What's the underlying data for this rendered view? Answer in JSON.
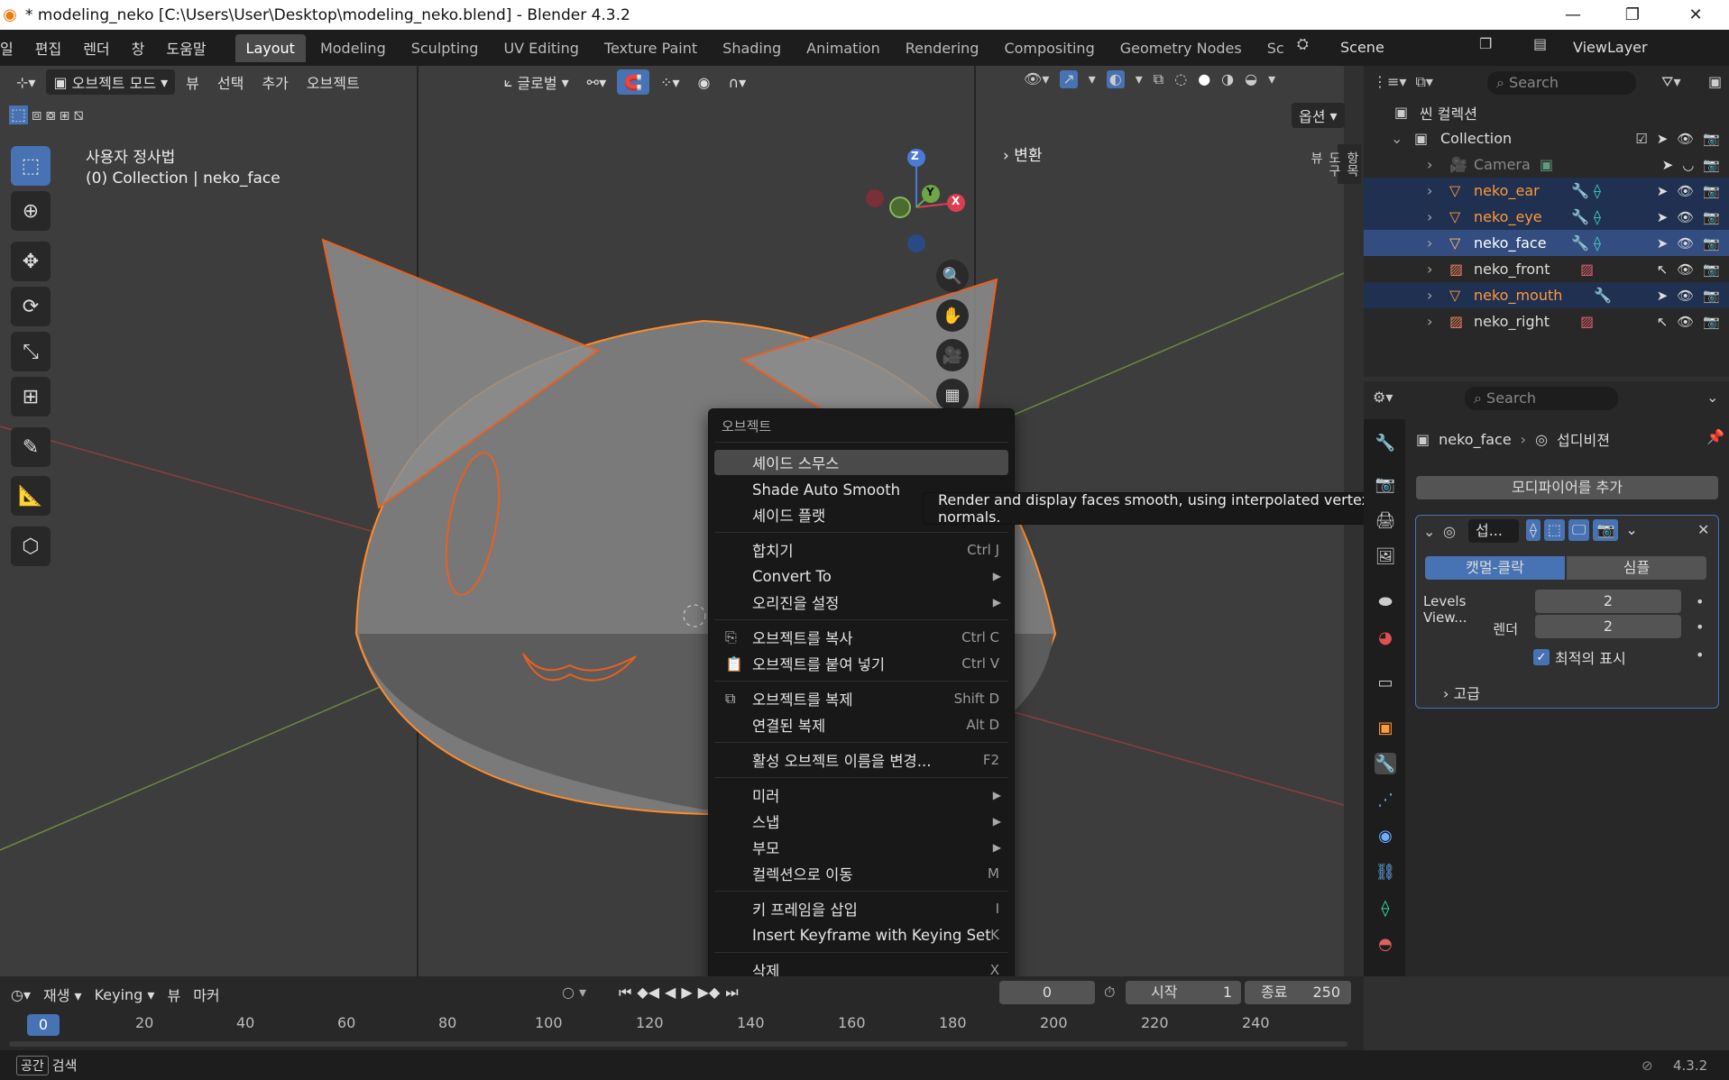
{
  "titlebar": {
    "title": "* modeling_neko [C:\\Users\\User\\Desktop\\modeling_neko.blend] - Blender 4.3.2",
    "minimize": "—",
    "maximize": "❐",
    "close": "✕"
  },
  "menubar": {
    "items": [
      "일",
      "편집",
      "렌더",
      "창",
      "도움말"
    ],
    "workspaces": [
      "Layout",
      "Modeling",
      "Sculpting",
      "UV Editing",
      "Texture Paint",
      "Shading",
      "Animation",
      "Rendering",
      "Compositing",
      "Geometry Nodes",
      "Sc"
    ],
    "active_workspace": "Layout",
    "scene": "Scene",
    "view_layer": "ViewLayer"
  },
  "viewport_header": {
    "mode": "오브젝트 모드",
    "menus": [
      "뷰",
      "선택",
      "추가",
      "오브젝트"
    ],
    "transform_orientation": "글로벌",
    "options": "옵션"
  },
  "viewport": {
    "view_name": "사용자 정사법",
    "collection_info": "(0) Collection | neko_face",
    "sidebar_panel": "변환",
    "side_tabs": [
      "항목",
      "도구",
      "뷰"
    ],
    "gizmo": {
      "z": "Z",
      "y": "Y",
      "x": "X"
    }
  },
  "context_menu": {
    "title": "오브젝트",
    "items": [
      {
        "label": "셰이드 스무스",
        "shortcut": "",
        "submenu": false,
        "highlighted": true
      },
      {
        "label": "Shade Auto Smooth",
        "shortcut": "",
        "submenu": false
      },
      {
        "label": "셰이드 플랫",
        "shortcut": "",
        "submenu": false
      },
      {
        "label": "합치기",
        "shortcut": "Ctrl J",
        "submenu": false
      },
      {
        "label": "Convert To",
        "shortcut": "",
        "submenu": true
      },
      {
        "label": "오리진을 설정",
        "shortcut": "",
        "submenu": true
      },
      {
        "label": "오브젝트를 복사",
        "shortcut": "Ctrl C",
        "submenu": false
      },
      {
        "label": "오브젝트를 붙여 넣기",
        "shortcut": "Ctrl V",
        "submenu": false
      },
      {
        "label": "오브젝트를 복제",
        "shortcut": "Shift D",
        "submenu": false
      },
      {
        "label": "연결된 복제",
        "shortcut": "Alt D",
        "submenu": false
      },
      {
        "label": "활성 오브젝트 이름을 변경...",
        "shortcut": "F2",
        "submenu": false
      },
      {
        "label": "미러",
        "shortcut": "",
        "submenu": true
      },
      {
        "label": "스냅",
        "shortcut": "",
        "submenu": true
      },
      {
        "label": "부모",
        "shortcut": "",
        "submenu": true
      },
      {
        "label": "컬렉션으로 이동",
        "shortcut": "M",
        "submenu": false
      },
      {
        "label": "키 프레임을 삽입",
        "shortcut": "I",
        "submenu": false
      },
      {
        "label": "Insert Keyframe with Keying Set",
        "shortcut": "K",
        "submenu": false
      },
      {
        "label": "삭제",
        "shortcut": "X",
        "submenu": false
      }
    ]
  },
  "tooltip": "Render and display faces smooth, using interpolated vertex normals.",
  "outliner": {
    "search_placeholder": "Search",
    "scene_collection": "씬 컬렉션",
    "collection": "Collection",
    "objects": [
      {
        "name": "Camera",
        "type": "camera",
        "selected": false
      },
      {
        "name": "neko_ear",
        "type": "mesh",
        "selected": true
      },
      {
        "name": "neko_eye",
        "type": "mesh",
        "selected": true
      },
      {
        "name": "neko_face",
        "type": "mesh",
        "selected": true,
        "active": true
      },
      {
        "name": "neko_front",
        "type": "image",
        "selected": false
      },
      {
        "name": "neko_mouth",
        "type": "mesh",
        "selected": true
      },
      {
        "name": "neko_right",
        "type": "image",
        "selected": false
      }
    ]
  },
  "properties": {
    "search_placeholder": "Search",
    "object_name": "neko_face",
    "modifier_crumb": "섭디비젼",
    "add_modifier": "모디파이어를 추가",
    "modifier_name": "섭...",
    "tabs": [
      "캣멀-클락",
      "심플"
    ],
    "fields": [
      {
        "label": "Levels View...",
        "value": "2"
      },
      {
        "label": "렌더",
        "value": "2"
      }
    ],
    "checkbox_label": "최적의 표시",
    "advanced": "고급"
  },
  "timeline": {
    "playback": "재생",
    "keying": "Keying",
    "view": "뷰",
    "marker": "마커",
    "current_frame": "0",
    "start_label": "시작",
    "start": "1",
    "end_label": "종료",
    "end": "250",
    "ticks": [
      "0",
      "20",
      "40",
      "60",
      "80",
      "100",
      "120",
      "140",
      "160",
      "180",
      "200",
      "220",
      "240"
    ]
  },
  "statusbar": {
    "key": "공간",
    "action": "검색",
    "version": "4.3.2"
  }
}
